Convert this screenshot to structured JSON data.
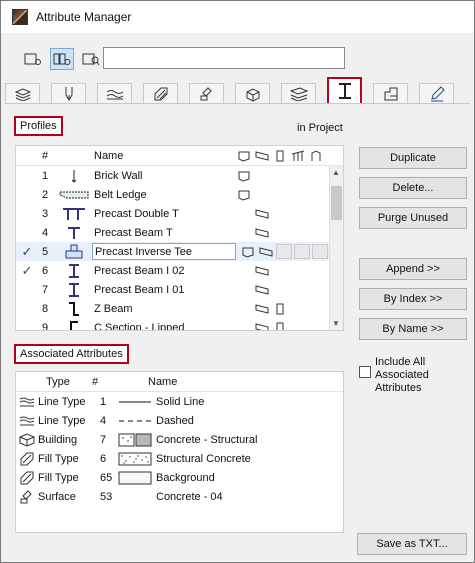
{
  "window": {
    "title": "Attribute Manager"
  },
  "tabs": [
    {
      "name": "layers"
    },
    {
      "name": "pen"
    },
    {
      "name": "line-type"
    },
    {
      "name": "fill"
    },
    {
      "name": "surface"
    },
    {
      "name": "building-material"
    },
    {
      "name": "composite"
    },
    {
      "name": "profile",
      "active": true
    },
    {
      "name": "zone"
    },
    {
      "name": "markup"
    }
  ],
  "profiles": {
    "label": "Profiles",
    "in_project_label": "in Project",
    "header": {
      "num": "#",
      "name": "Name"
    },
    "rows": [
      {
        "checked": false,
        "num": "1",
        "name": "Brick Wall"
      },
      {
        "checked": false,
        "num": "2",
        "name": "Belt Ledge"
      },
      {
        "checked": false,
        "num": "3",
        "name": "Precast Double T"
      },
      {
        "checked": false,
        "num": "4",
        "name": "Precast Beam T"
      },
      {
        "checked": true,
        "num": "5",
        "name": "Precast Inverse Tee",
        "selected": true
      },
      {
        "checked": true,
        "num": "6",
        "name": "Precast Beam I 02"
      },
      {
        "checked": false,
        "num": "7",
        "name": "Precast Beam I 01"
      },
      {
        "checked": false,
        "num": "8",
        "name": "Z Beam"
      },
      {
        "checked": false,
        "num": "9",
        "name": "C Section - Lipped"
      }
    ]
  },
  "buttons": {
    "duplicate": "Duplicate",
    "delete": "Delete...",
    "purge": "Purge Unused",
    "append": "Append >>",
    "by_index": "By Index >>",
    "by_name": "By Name >>",
    "save_txt": "Save as TXT..."
  },
  "associated": {
    "label": "Associated Attributes",
    "header": {
      "type": "Type",
      "num": "#",
      "name": "Name"
    },
    "rows": [
      {
        "icon": "line-type-icon",
        "type": "Line Type",
        "num": "1",
        "name": "Solid Line"
      },
      {
        "icon": "line-type-icon",
        "type": "Line Type",
        "num": "4",
        "name": "Dashed"
      },
      {
        "icon": "building-icon",
        "type": "Building",
        "num": "7",
        "name": "Concrete - Structural"
      },
      {
        "icon": "fill-icon",
        "type": "Fill Type",
        "num": "6",
        "name": "Structural Concrete"
      },
      {
        "icon": "fill-icon",
        "type": "Fill Type",
        "num": "65",
        "name": "Background"
      },
      {
        "icon": "surface-icon",
        "type": "Surface",
        "num": "53",
        "name": "Concrete - 04"
      }
    ]
  },
  "include_all": {
    "label": "Include All Associated Attributes",
    "checked": false
  },
  "colors": {
    "highlight": "#c0001a",
    "selection": "#7aa7d6"
  }
}
